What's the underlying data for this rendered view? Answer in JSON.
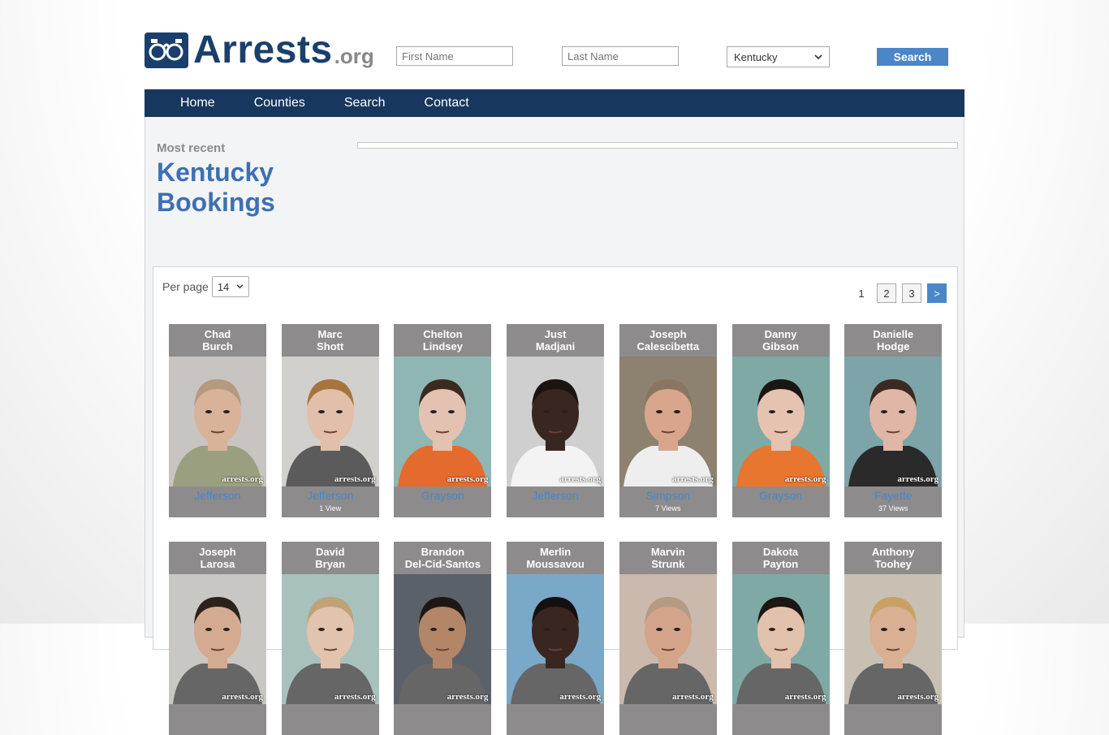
{
  "site": {
    "logo_main": "Arrests",
    "logo_ext": ".org"
  },
  "search": {
    "first_placeholder": "First Name",
    "last_placeholder": "Last Name",
    "state_selected": "Kentucky",
    "button": "Search"
  },
  "nav": [
    "Home",
    "Counties",
    "Search",
    "Contact"
  ],
  "heading": {
    "kicker": "Most recent",
    "line1": "Kentucky",
    "line2": "Bookings"
  },
  "listing": {
    "per_page_label": "Per page",
    "per_page_value": "14",
    "pages": [
      "1",
      "2",
      "3"
    ],
    "next_label": ">",
    "watermark": "arrests.org"
  },
  "bookings": [
    {
      "first": "Chad",
      "last": "Burch",
      "county": "Jefferson",
      "views": "",
      "bg": "#c7c4c2",
      "shirt": "#9aa07f",
      "skin": "#d9b29a",
      "hair": "#b49a7e"
    },
    {
      "first": "Marc",
      "last": "Shott",
      "county": "Jefferson",
      "views": "1 View",
      "bg": "#d2d0cd",
      "shirt": "#5b5b5b",
      "skin": "#e2bfaa",
      "hair": "#a8743e"
    },
    {
      "first": "Chelton",
      "last": "Lindsey",
      "county": "Grayson",
      "views": "",
      "bg": "#8fb6b2",
      "shirt": "#e56a2e",
      "skin": "#e4c2b2",
      "hair": "#3b2a1f"
    },
    {
      "first": "Just",
      "last": "Madjani",
      "county": "Jefferson",
      "views": "",
      "bg": "#cfcfcf",
      "shirt": "#f3f3f3",
      "skin": "#3a2620",
      "hair": "#1c1412"
    },
    {
      "first": "Joseph",
      "last": "Calescibetta",
      "county": "Simpson",
      "views": "7 Views",
      "bg": "#8d8170",
      "shirt": "#eeeeee",
      "skin": "#d8a58d",
      "hair": "#8a7560"
    },
    {
      "first": "Danny",
      "last": "Gibson",
      "county": "Grayson",
      "views": "",
      "bg": "#7ea9a5",
      "shirt": "#e8762f",
      "skin": "#e6c3b0",
      "hair": "#1b1614"
    },
    {
      "first": "Danielle",
      "last": "Hodge",
      "county": "Fayette",
      "views": "37 Views",
      "bg": "#7da4a8",
      "shirt": "#2a2a2a",
      "skin": "#e0b6a6",
      "hair": "#3a2a22"
    },
    {
      "first": "Joseph",
      "last": "Larosa",
      "county": "",
      "views": "",
      "bg": "#c9c7c4",
      "shirt": "#666",
      "skin": "#d4aa90",
      "hair": "#2b221d"
    },
    {
      "first": "David",
      "last": "Bryan",
      "county": "",
      "views": "",
      "bg": "#a8c1bd",
      "shirt": "#666",
      "skin": "#e1c3ae",
      "hair": "#bfa276"
    },
    {
      "first": "Brandon",
      "last": "Del-Cid-Santos",
      "county": "",
      "views": "",
      "bg": "#5a6169",
      "shirt": "#666",
      "skin": "#b28666",
      "hair": "#1e1814"
    },
    {
      "first": "Merlin",
      "last": "Moussavou",
      "county": "",
      "views": "",
      "bg": "#7aa8c9",
      "shirt": "#666",
      "skin": "#3a2620",
      "hair": "#141010"
    },
    {
      "first": "Marvin",
      "last": "Strunk",
      "county": "",
      "views": "",
      "bg": "#cbb9ad",
      "shirt": "#666",
      "skin": "#d3a48a",
      "hair": "#b59b84"
    },
    {
      "first": "Dakota",
      "last": "Payton",
      "county": "",
      "views": "",
      "bg": "#7fa9a5",
      "shirt": "#666",
      "skin": "#e2c1ad",
      "hair": "#1c1614"
    },
    {
      "first": "Anthony",
      "last": "Toohey",
      "county": "",
      "views": "",
      "bg": "#c9c0b4",
      "shirt": "#666",
      "skin": "#d9b093",
      "hair": "#c9a165"
    }
  ]
}
